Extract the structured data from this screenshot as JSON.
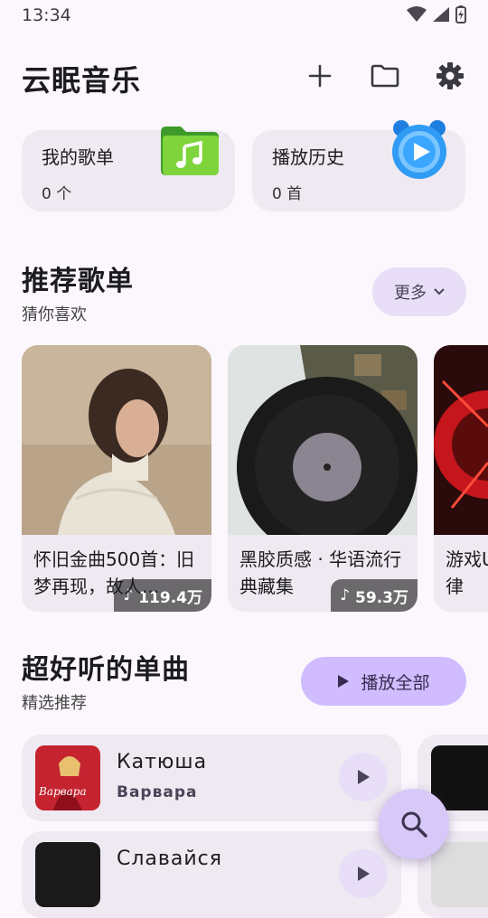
{
  "status": {
    "time": "13:34"
  },
  "header": {
    "title": "云眠音乐",
    "icons": [
      "add-icon",
      "folder-icon",
      "gear-icon"
    ]
  },
  "quick": [
    {
      "title": "我的歌单",
      "count": "0 个",
      "icon": "music-folder-icon"
    },
    {
      "title": "播放历史",
      "count": "0 首",
      "icon": "alarm-clock-play-icon"
    }
  ],
  "recommend": {
    "title": "推荐歌单",
    "subtitle": "猜你喜欢",
    "more_label": "更多",
    "playlists": [
      {
        "name": "怀旧金曲500首：旧梦再现，故人...",
        "plays": "119.4万"
      },
      {
        "name": "黑胶质感 · 华语流行典藏集",
        "plays": "59.3万"
      },
      {
        "name": "游戏U 胜旋律",
        "plays": ""
      }
    ]
  },
  "singles": {
    "title": "超好听的单曲",
    "subtitle": "精选推荐",
    "play_all_label": "播放全部",
    "songs": [
      {
        "title": "Катюша",
        "artist": "Варвара",
        "cover_text": "Варвара"
      },
      {
        "title": "Славайся",
        "artist": "",
        "cover_text": ""
      }
    ]
  },
  "colors": {
    "accent": "#d0bcff",
    "card": "#efe9f2",
    "chip": "#e8def8",
    "background": "#fbf7fd"
  }
}
